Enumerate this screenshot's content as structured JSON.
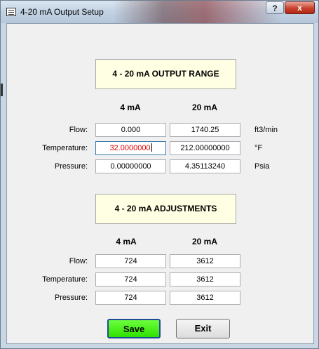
{
  "window": {
    "title": "4-20 mA Output Setup",
    "help_label": "?",
    "close_label": "x"
  },
  "output_range": {
    "heading": "4 - 20 mA OUTPUT RANGE",
    "col_4": "4 mA",
    "col_20": "20 mA",
    "rows": [
      {
        "label": "Flow:",
        "v4": "0.000",
        "v20": "1740.25",
        "unit": "ft3/min"
      },
      {
        "label": "Temperature:",
        "v4": "32.0000000",
        "v20": "212.00000000",
        "unit": "°F"
      },
      {
        "label": "Pressure:",
        "v4": "0.00000000",
        "v20": "4.35113240",
        "unit": "Psia"
      }
    ]
  },
  "adjustments": {
    "heading": "4 - 20 mA ADJUSTMENTS",
    "col_4": "4 mA",
    "col_20": "20 mA",
    "rows": [
      {
        "label": "Flow:",
        "v4": "724",
        "v20": "3612"
      },
      {
        "label": "Temperature:",
        "v4": "724",
        "v20": "3612"
      },
      {
        "label": "Pressure:",
        "v4": "724",
        "v20": "3612"
      }
    ]
  },
  "buttons": {
    "save": "Save",
    "exit": "Exit"
  },
  "colors": {
    "save_green": "#3cf00c",
    "active_text": "#e00000",
    "panel_bg": "#ffffe3"
  }
}
